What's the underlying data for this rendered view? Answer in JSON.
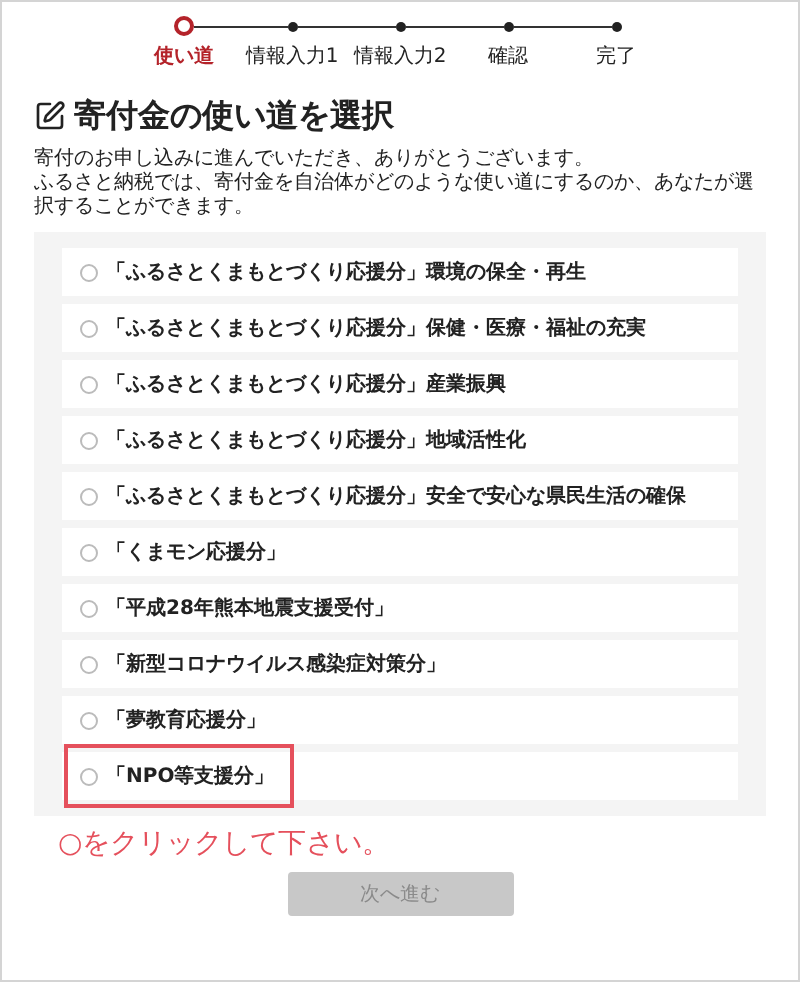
{
  "steps": [
    {
      "label": "使い道",
      "selected": true
    },
    {
      "label": "情報入力1",
      "selected": false
    },
    {
      "label": "情報入力2",
      "selected": false
    },
    {
      "label": "確認",
      "selected": false
    },
    {
      "label": "完了",
      "selected": false
    }
  ],
  "heading": "寄付金の使い道を選択",
  "description": [
    "寄付のお申し込みに進んでいただき、ありがとうございます。",
    "ふるさと納税では、寄付金を自治体がどのような使い道にするのか、あなたが選択することができます。"
  ],
  "options": [
    {
      "label": "「ふるさとくまもとづくり応援分」環境の保全・再生",
      "selected": false,
      "highlighted": false
    },
    {
      "label": "「ふるさとくまもとづくり応援分」保健・医療・福祉の充実",
      "selected": false,
      "highlighted": false
    },
    {
      "label": "「ふるさとくまもとづくり応援分」産業振興",
      "selected": false,
      "highlighted": false
    },
    {
      "label": "「ふるさとくまもとづくり応援分」地域活性化",
      "selected": false,
      "highlighted": false
    },
    {
      "label": "「ふるさとくまもとづくり応援分」安全で安心な県民生活の確保",
      "selected": false,
      "highlighted": false
    },
    {
      "label": "「くまモン応援分」",
      "selected": false,
      "highlighted": false
    },
    {
      "label": "「平成28年熊本地震支援受付」",
      "selected": false,
      "highlighted": false
    },
    {
      "label": "「新型コロナウイルス感染症対策分」",
      "selected": false,
      "highlighted": false
    },
    {
      "label": "「夢教育応援分」",
      "selected": false,
      "highlighted": false
    },
    {
      "label": "「NPO等支援分」",
      "selected": false,
      "highlighted": true
    }
  ],
  "hint": "○をクリックして下さい。",
  "next_button": {
    "label": "次へ進む",
    "disabled": true
  }
}
